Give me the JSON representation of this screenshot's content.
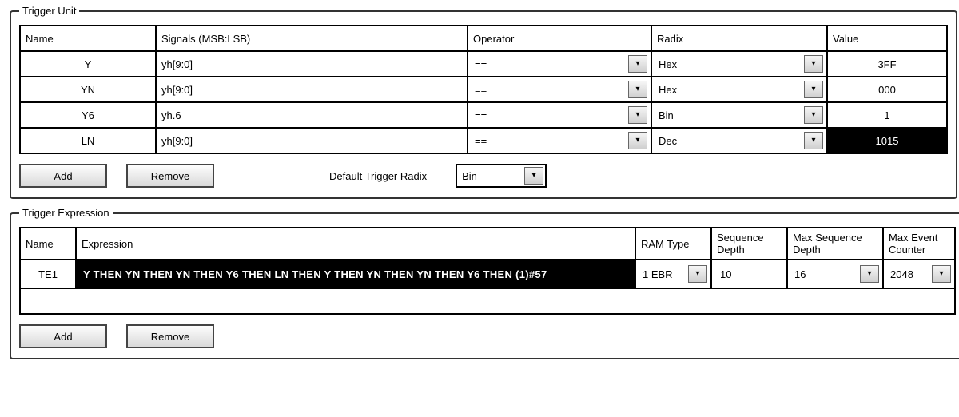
{
  "trigger_unit": {
    "legend": "Trigger Unit",
    "headers": {
      "name": "Name",
      "signals": "Signals (MSB:LSB)",
      "operator": "Operator",
      "radix": "Radix",
      "value": "Value"
    },
    "rows": [
      {
        "name": "Y",
        "signals": "yh[9:0]",
        "operator": "==",
        "radix": "Hex",
        "value": "3FF",
        "value_inverted": false
      },
      {
        "name": "YN",
        "signals": "yh[9:0]",
        "operator": "==",
        "radix": "Hex",
        "value": "000",
        "value_inverted": false
      },
      {
        "name": "Y6",
        "signals": "yh.6",
        "operator": "==",
        "radix": "Bin",
        "value": "1",
        "value_inverted": false
      },
      {
        "name": "LN",
        "signals": "yh[9:0]",
        "operator": "==",
        "radix": "Dec",
        "value": "1015",
        "value_inverted": true
      }
    ],
    "buttons": {
      "add": "Add",
      "remove": "Remove"
    },
    "default_radix_label": "Default Trigger Radix",
    "default_radix_value": "Bin"
  },
  "trigger_expression": {
    "legend": "Trigger Expression",
    "headers": {
      "name": "Name",
      "expression": "Expression",
      "ram_type": "RAM Type",
      "seq_depth": "Sequence Depth",
      "max_seq_depth": "Max Sequence Depth",
      "max_event_counter": "Max Event Counter"
    },
    "rows": [
      {
        "name": "TE1",
        "expression": "Y THEN YN THEN YN THEN Y6 THEN LN THEN Y THEN YN THEN YN THEN Y6 THEN (1)#57",
        "ram_type": "1 EBR",
        "seq_depth": "10",
        "max_seq_depth": "16",
        "max_event_counter": "2048"
      }
    ],
    "buttons": {
      "add": "Add",
      "remove": "Remove"
    }
  },
  "icons": {
    "chevron_down": "▾"
  }
}
